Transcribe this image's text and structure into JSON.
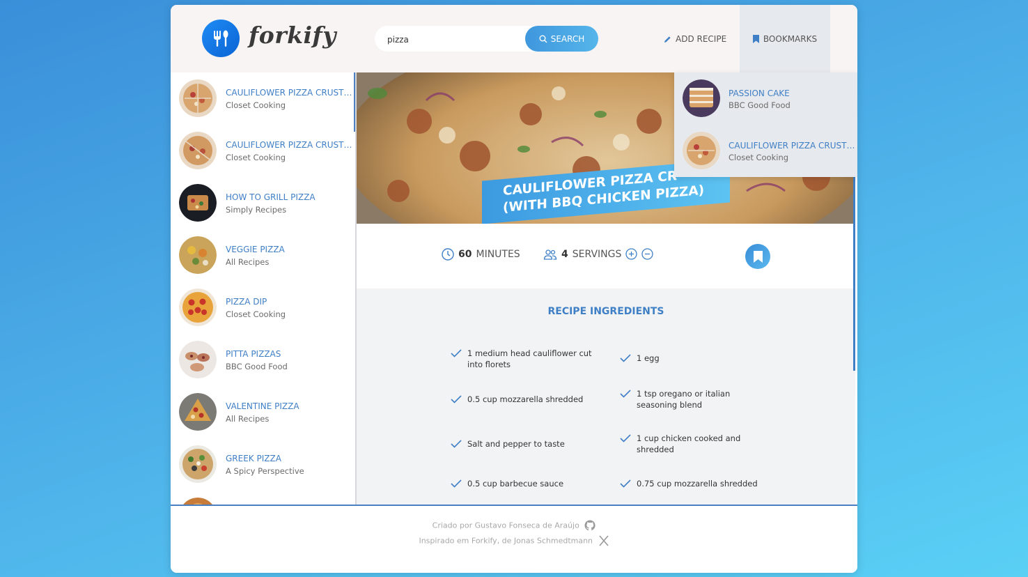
{
  "header": {
    "logo_text": "forkify",
    "search_value": "pizza",
    "search_button": "SEARCH",
    "add_recipe": "ADD RECIPE",
    "bookmarks": "BOOKMARKS"
  },
  "results": [
    {
      "title": "CAULIFLOWER PIZZA CRUST ...",
      "publisher": "Closet Cooking"
    },
    {
      "title": "CAULIFLOWER PIZZA CRUST ...",
      "publisher": "Closet Cooking"
    },
    {
      "title": "HOW TO GRILL PIZZA",
      "publisher": "Simply Recipes"
    },
    {
      "title": "VEGGIE PIZZA",
      "publisher": "All Recipes"
    },
    {
      "title": "PIZZA DIP",
      "publisher": "Closet Cooking"
    },
    {
      "title": "PITTA PIZZAS",
      "publisher": "BBC Good Food"
    },
    {
      "title": "VALENTINE PIZZA",
      "publisher": "All Recipes"
    },
    {
      "title": "GREEK PIZZA",
      "publisher": "A Spicy Perspective"
    }
  ],
  "recipe": {
    "title_line1": "CAULIFLOWER PIZZA CR",
    "title_line2": "(WITH BBQ CHICKEN PIZZA)",
    "minutes": "60",
    "minutes_label": "MINUTES",
    "servings": "4",
    "servings_label": "SERVINGS",
    "ingredients_heading": "RECIPE INGREDIENTS",
    "ingredients_left": [
      "1 medium head cauliflower cut into florets",
      "0.5 cup mozzarella shredded",
      "Salt and pepper to taste",
      "0.5 cup barbecue sauce"
    ],
    "ingredients_right": [
      "1 egg",
      "1 tsp oregano or italian seasoning blend",
      "1 cup chicken cooked and shredded",
      "0.75 cup mozzarella shredded"
    ]
  },
  "bookmarks_list": [
    {
      "title": "PASSION CAKE",
      "publisher": "BBC Good Food"
    },
    {
      "title": "CAULIFLOWER PIZZA CRUST ...",
      "publisher": "Closet Cooking"
    }
  ],
  "footer": {
    "line1": "Criado por Gustavo Fonseca de Araújo",
    "line2": "Inspirado em Forkify, de Jonas Schmedtmann"
  },
  "colors": {
    "accent": "#3f7fc6",
    "brand_gradient_start": "#3f97dd",
    "brand_gradient_end": "#56b5ea"
  }
}
